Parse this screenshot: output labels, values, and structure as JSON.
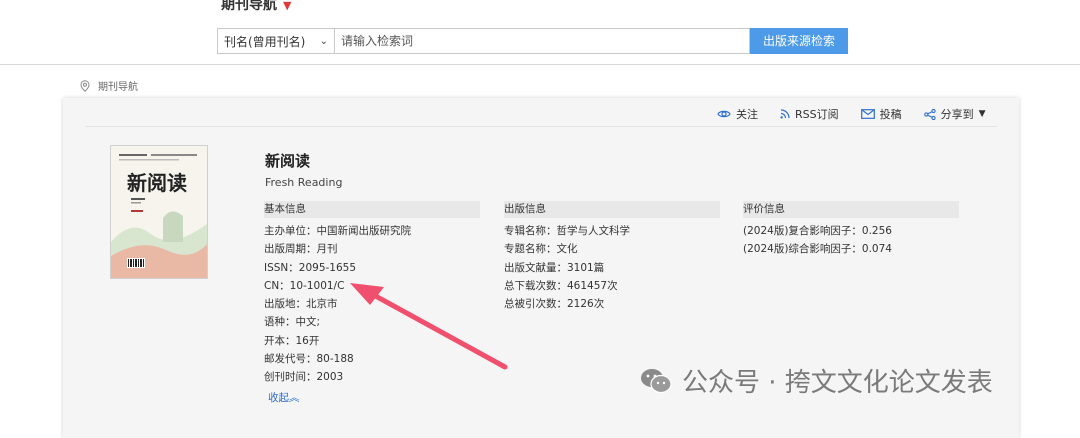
{
  "header": {
    "nav_title": "期刊导航",
    "search_select": "刊名(曾用刊名)",
    "search_placeholder": "请输入检索词",
    "search_button": "出版来源检索"
  },
  "breadcrumb": "期刊导航",
  "actions": {
    "follow": "关注",
    "rss": "RSS订阅",
    "submit": "投稿",
    "share": "分享到"
  },
  "journal": {
    "title_cn": "新阅读",
    "title_en": "Fresh Reading",
    "cover_title": "新阅读"
  },
  "basic_info": {
    "heading": "基本信息",
    "rows": [
      "主办单位：中国新闻出版研究院",
      "出版周期：月刊",
      "ISSN：2095-1655",
      "CN：10-1001/C",
      "出版地：北京市",
      "语种：中文;",
      "开本：16开",
      "邮发代号：80-188",
      "创刊时间：2003"
    ],
    "collapse": "收起"
  },
  "publish_info": {
    "heading": "出版信息",
    "rows": [
      "专辑名称：哲学与人文科学",
      "专题名称：文化",
      "出版文献量：3101篇",
      "总下载次数：461457次",
      "总被引次数：2126次"
    ]
  },
  "eval_info": {
    "heading": "评价信息",
    "rows": [
      "(2024版)复合影响因子：0.256",
      "(2024版)综合影响因子：0.074"
    ]
  },
  "watermark": "公众号 · 挎文文化论文发表",
  "colors": {
    "accent_blue": "#4c9ae8",
    "link_blue": "#2f6fd0",
    "arrow_red": "#f0506e",
    "caret_red": "#e03b3b"
  }
}
